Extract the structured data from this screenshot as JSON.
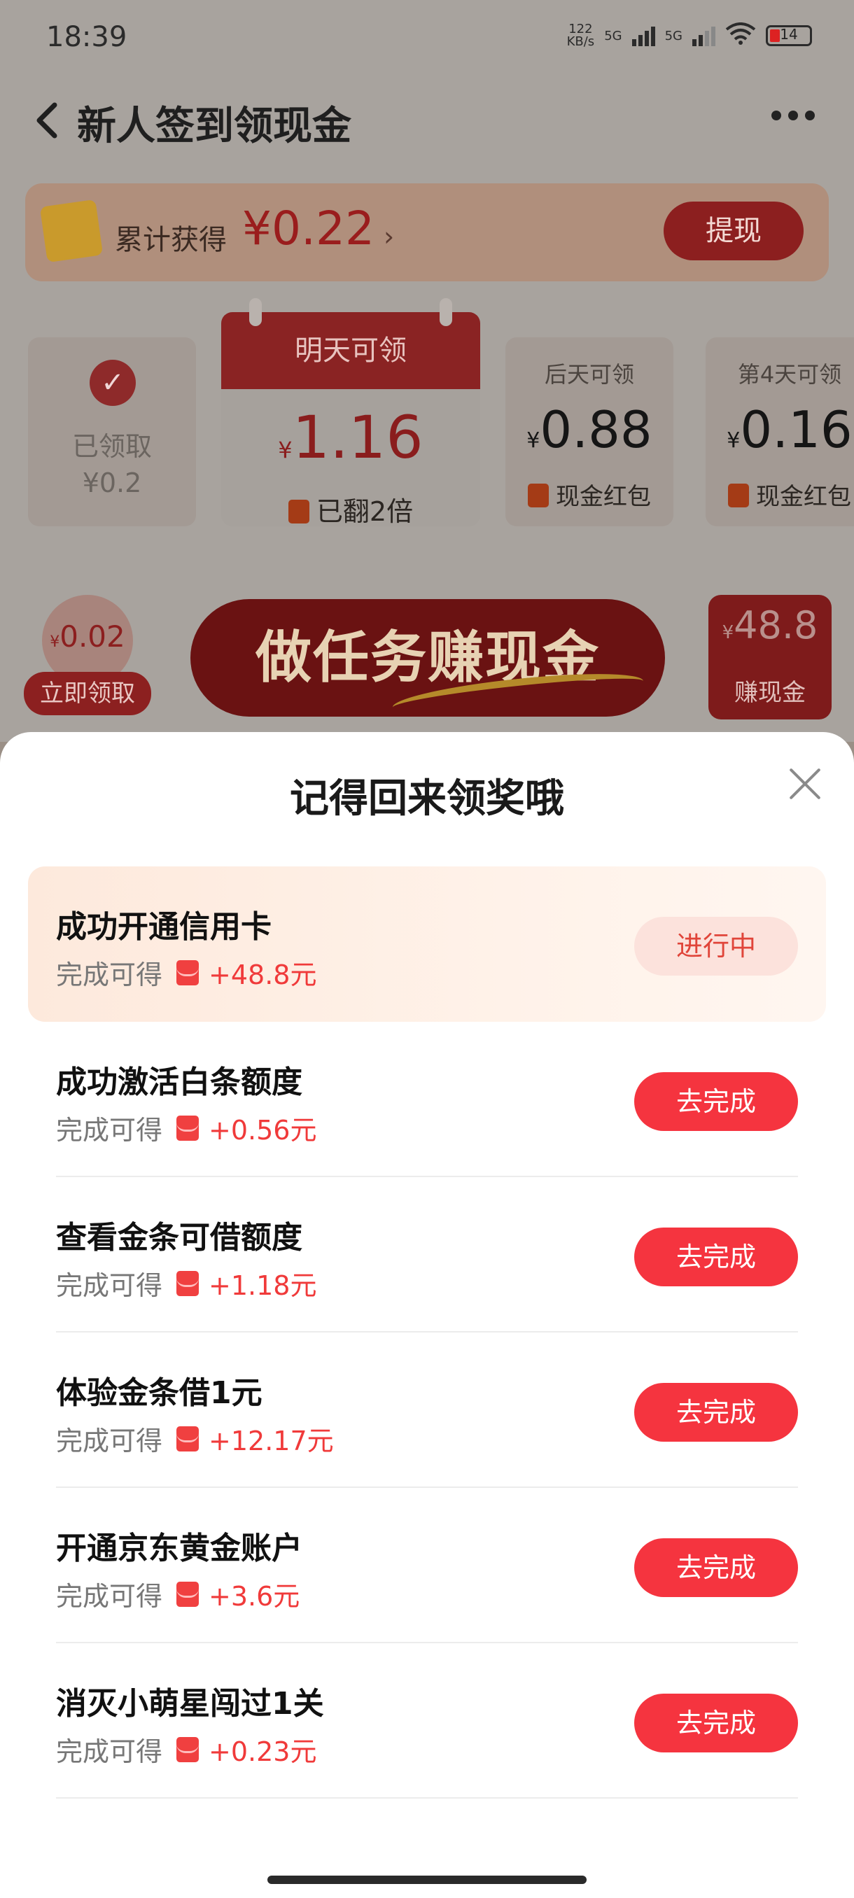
{
  "status": {
    "time": "18:39",
    "net_speed": "122\nKB/s",
    "signal1": "5G",
    "signal2": "5G",
    "battery": "14"
  },
  "header": {
    "title": "新人签到领现金"
  },
  "earnings": {
    "label": "累计获得",
    "amount": "¥0.22",
    "chevron": "›",
    "withdraw_label": "提现"
  },
  "days": [
    {
      "state": "已领取",
      "value": "¥0.2"
    },
    {
      "caption": "明天可领",
      "currency": "¥",
      "amount": "1.16",
      "tag": "已翻2倍"
    },
    {
      "caption": "后天可领",
      "currency": "¥",
      "amount": "0.88",
      "tag": "现金红包"
    },
    {
      "caption": "第4天可领",
      "currency": "¥",
      "amount": "0.16",
      "tag": "现金红包"
    }
  ],
  "promo": {
    "bubble_currency": "¥",
    "bubble_value": "0.02",
    "claim_label": "立即领取",
    "banner_text": "做任务赚现金",
    "side_currency": "¥",
    "side_value": "48.8",
    "side_label": "赚现金"
  },
  "sheet": {
    "title": "记得回来领奖哦",
    "tasks": [
      {
        "title": "成功开通信用卡",
        "prefix": "完成可得",
        "reward": "+48.8元",
        "button": "进行中",
        "status": "in-progress"
      },
      {
        "title": "成功激活白条额度",
        "prefix": "完成可得",
        "reward": "+0.56元",
        "button": "去完成",
        "status": "todo"
      },
      {
        "title": "查看金条可借额度",
        "prefix": "完成可得",
        "reward": "+1.18元",
        "button": "去完成",
        "status": "todo"
      },
      {
        "title": "体验金条借1元",
        "prefix": "完成可得",
        "reward": "+12.17元",
        "button": "去完成",
        "status": "todo"
      },
      {
        "title": "开通京东黄金账户",
        "prefix": "完成可得",
        "reward": "+3.6元",
        "button": "去完成",
        "status": "todo"
      },
      {
        "title": "消灭小萌星闯过1关",
        "prefix": "完成可得",
        "reward": "+0.23元",
        "button": "去完成",
        "status": "todo"
      }
    ]
  },
  "colors": {
    "accent": "#f5343f",
    "reward": "#f03a3a",
    "progress_bg": "#fce2dc"
  }
}
